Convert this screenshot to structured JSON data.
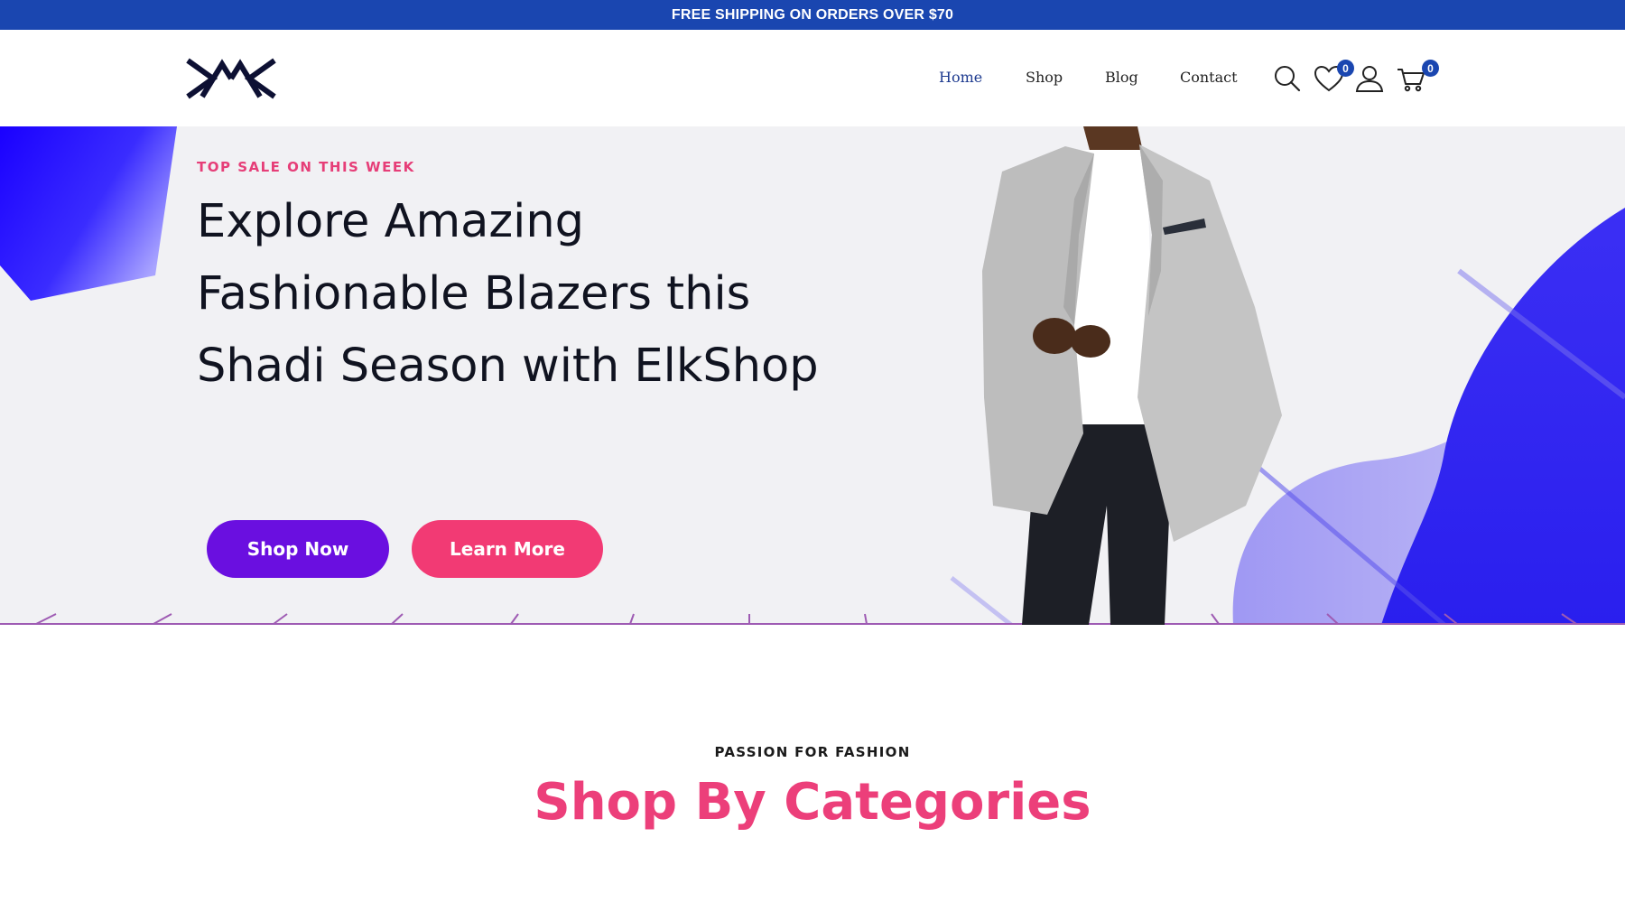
{
  "announcement": {
    "text": "FREE SHIPPING ON ORDERS OVER $70"
  },
  "header": {
    "logo_icon": "elkshop-logo",
    "nav": [
      {
        "label": "Home",
        "active": true
      },
      {
        "label": "Shop",
        "active": false
      },
      {
        "label": "Blog",
        "active": false
      },
      {
        "label": "Contact",
        "active": false
      }
    ],
    "icons": {
      "search": "search-icon",
      "wishlist": "heart-icon",
      "account": "user-icon",
      "cart": "cart-icon"
    },
    "wishlist_count": "0",
    "cart_count": "0"
  },
  "hero": {
    "eyebrow": "TOP SALE ON THIS WEEK",
    "headline": "Explore Amazing Fashionable Blazers this Shadi Season with ElkShop",
    "buttons": {
      "primary": "Shop Now",
      "secondary": "Learn More"
    }
  },
  "categories": {
    "kicker": "PASSION FOR FASHION",
    "title": "Shop By Categories"
  },
  "colors": {
    "topbar": "#1a46b0",
    "nav_active": "#1d3a8f",
    "accent_pink": "#ec3f7a",
    "primary_button": "#6a0fe0",
    "secondary_button": "#f23a74",
    "hero_bg": "#f1f1f4",
    "blob_blue": "#2a22f0"
  }
}
